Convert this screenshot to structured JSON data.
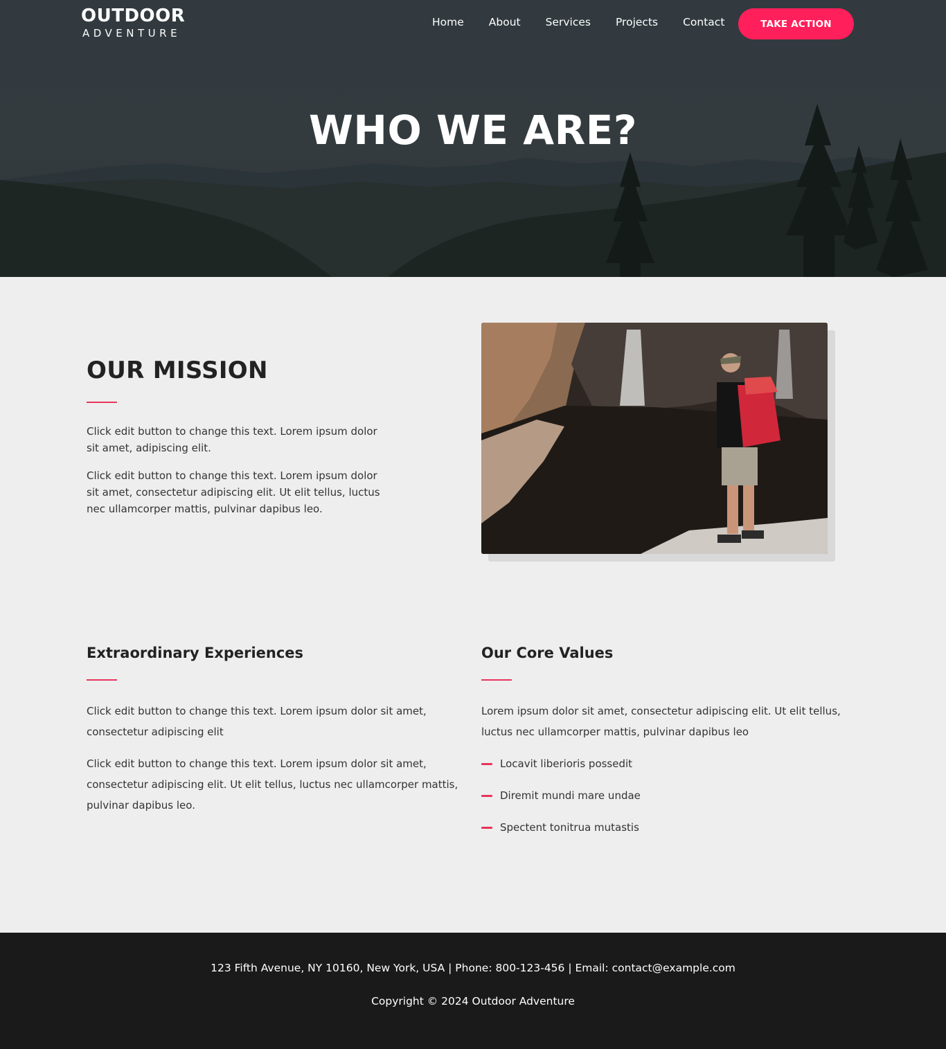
{
  "brand": {
    "line1": "OUTDOOR",
    "line2": "ADVENTURE"
  },
  "nav": {
    "items": [
      "Home",
      "About",
      "Services",
      "Projects",
      "Contact"
    ],
    "cta_label": "TAKE ACTION"
  },
  "hero": {
    "title": "WHO WE ARE?"
  },
  "mission": {
    "title": "OUR MISSION",
    "paragraphs": [
      "Click edit button to change this text. Lorem ipsum dolor sit amet, adipiscing elit.",
      "Click edit button to change this text. Lorem ipsum dolor sit amet, consectetur adipiscing elit. Ut elit tellus, luctus nec ullamcorper mattis, pulvinar dapibus leo."
    ]
  },
  "experiences": {
    "title": "Extraordinary Experiences",
    "paragraphs": [
      "Click edit button to change this text. Lorem ipsum dolor sit amet, consectetur adipiscing elit",
      "Click edit button to change this text. Lorem ipsum dolor sit amet, consectetur adipiscing elit. Ut elit tellus, luctus nec ullamcorper mattis, pulvinar dapibus leo."
    ]
  },
  "values": {
    "title": "Our Core Values",
    "intro": "Lorem ipsum dolor sit amet, consectetur adipiscing elit. Ut elit tellus, luctus nec ullamcorper mattis, pulvinar dapibus leo",
    "items": [
      "Locavit liberioris possedit",
      "Diremit mundi mare undae",
      "Spectent tonitrua mutastis"
    ]
  },
  "footer": {
    "contact": "123 Fifth Avenue, NY 10160, New York, USA | Phone: 800-123-456 | Email: contact@example.com",
    "copyright": "Copyright © 2024 Outdoor Adventure"
  },
  "colors": {
    "accent": "#ff1f5a",
    "divider": "#e8345b",
    "footer_bg": "#1a1a1a",
    "page_bg": "#eeeeee"
  }
}
